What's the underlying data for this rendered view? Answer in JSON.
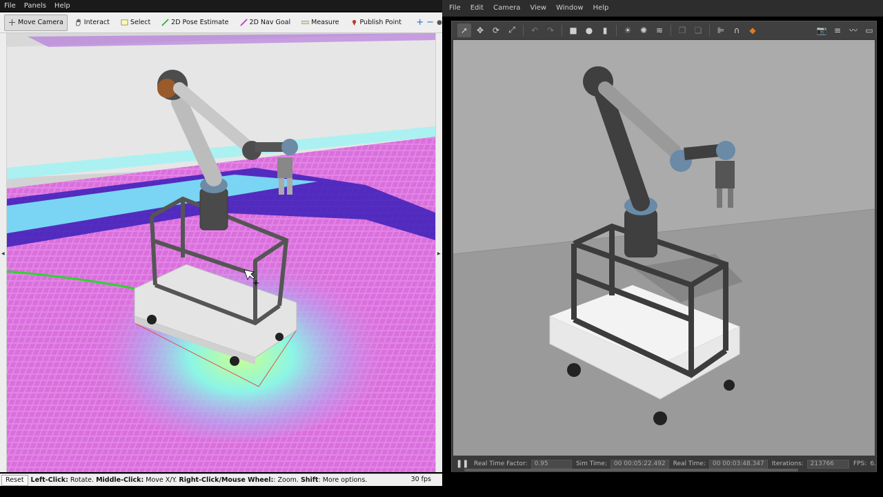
{
  "rviz": {
    "menu": [
      "File",
      "Panels",
      "Help"
    ],
    "tools": [
      {
        "label": "Move Camera",
        "icon": "move-camera-icon",
        "active": true
      },
      {
        "label": "Interact",
        "icon": "hand-icon",
        "active": false
      },
      {
        "label": "Select",
        "icon": "select-box-icon",
        "active": false
      },
      {
        "label": "2D Pose Estimate",
        "icon": "green-arrow-icon",
        "active": false
      },
      {
        "label": "2D Nav Goal",
        "icon": "pink-arrow-icon",
        "active": false
      },
      {
        "label": "Measure",
        "icon": "ruler-icon",
        "active": false
      },
      {
        "label": "Publish Point",
        "icon": "pin-icon",
        "active": false
      }
    ],
    "zoom_icons": [
      "+",
      "−",
      "●"
    ],
    "status": {
      "reset_label": "Reset",
      "left_click": "Left-Click:",
      "left_click_desc": " Rotate. ",
      "middle_click": "Middle-Click:",
      "middle_click_desc": " Move X/Y. ",
      "right_click": "Right-Click/Mouse Wheel:",
      "right_click_desc": ": Zoom. ",
      "shift": "Shift",
      "shift_desc": ": More options.",
      "fps": "30 fps"
    }
  },
  "gazebo": {
    "menu": [
      "File",
      "Edit",
      "Camera",
      "View",
      "Window",
      "Help"
    ],
    "stats": {
      "rtf_label": "Real Time Factor:",
      "rtf_value": "0.95",
      "sim_time_label": "Sim Time:",
      "sim_time_value": "00 00:05:22.492",
      "real_time_label": "Real Time:",
      "real_time_value": "00 00:03:48.347",
      "iterations_label": "Iterations:",
      "iterations_value": "213766",
      "fps_label": "FPS:",
      "fps_value": "6."
    }
  },
  "colors": {
    "rviz_toolbar": "#efefef",
    "gazebo_bg": "#a8a8a8",
    "costmap_pink": "#e070e0",
    "costmap_cyan": "#80ffff",
    "robot_grey": "#4a4a4a"
  }
}
